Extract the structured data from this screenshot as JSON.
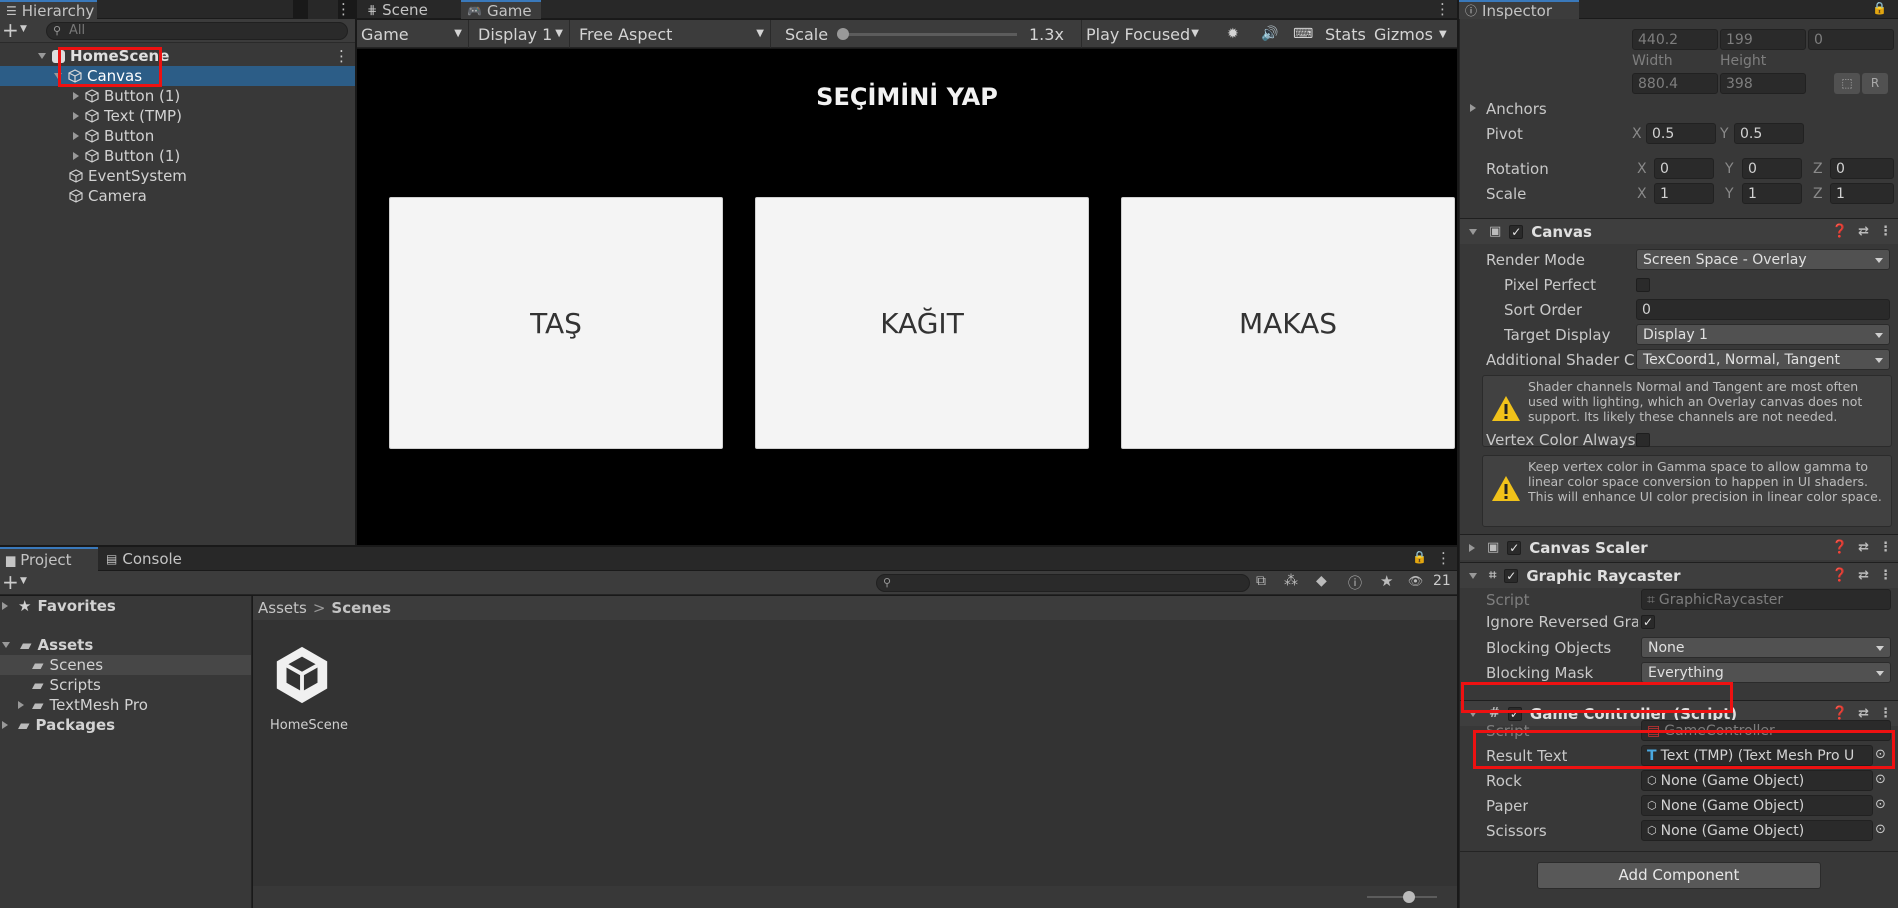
{
  "hierarchy": {
    "tab_label": "Hierarchy",
    "search_placeholder": "All",
    "scene_name": "HomeScene",
    "items": [
      {
        "label": "Canvas"
      },
      {
        "label": "Button (1)"
      },
      {
        "label": "Text (TMP)"
      },
      {
        "label": "Button"
      },
      {
        "label": "Button (1)"
      },
      {
        "label": "EventSystem"
      },
      {
        "label": "Camera"
      }
    ]
  },
  "center_tabs": {
    "scene": "Scene",
    "game": "Game"
  },
  "game_toolbar": {
    "game": "Game",
    "display": "Display 1",
    "aspect": "Free Aspect",
    "scale_label": "Scale",
    "scale_value": "1.3x",
    "play_mode": "Play Focused",
    "stats": "Stats",
    "gizmos": "Gizmos",
    "scale_fraction": 0.0
  },
  "game_view": {
    "title": "SEÇİMİNİ YAP",
    "cards": [
      "TAŞ",
      "KAĞIT",
      "MAKAS"
    ]
  },
  "project": {
    "tabs": {
      "project": "Project",
      "console": "Console"
    },
    "badge": "21",
    "tree": {
      "favorites": "Favorites",
      "assets": "Assets",
      "scenes": "Scenes",
      "scripts": "Scripts",
      "textmesh": "TextMesh Pro",
      "packages": "Packages"
    },
    "breadcrumb": {
      "root": "Assets",
      "sep": ">",
      "current": "Scenes"
    },
    "files": [
      {
        "label": "HomeScene"
      }
    ]
  },
  "inspector": {
    "tab_label": "Inspector",
    "rect": {
      "pos_x": "440.2",
      "pos_y": "199",
      "pos_z": "0",
      "width_label": "Width",
      "height_label": "Height",
      "width": "880.4",
      "height": "398",
      "anchors": "Anchors",
      "pivot": "Pivot",
      "pivot_x": "0.5",
      "pivot_y": "0.5",
      "rotation": "Rotation",
      "scale": "Scale",
      "rot": [
        "0",
        "0",
        "0"
      ],
      "scl": [
        "1",
        "1",
        "1"
      ],
      "x": "X",
      "y": "Y",
      "z": "Z"
    },
    "canvas": {
      "title": "Canvas",
      "render_mode_label": "Render Mode",
      "render_mode": "Screen Space - Overlay",
      "pixel_perfect": "Pixel Perfect",
      "sort_order_label": "Sort Order",
      "sort_order": "0",
      "target_display_label": "Target Display",
      "target_display": "Display 1",
      "shader_label": "Additional Shader Ch",
      "shader_value": "TexCoord1, Normal, Tangent",
      "warning1": "Shader channels Normal and Tangent are most often used with lighting, which an Overlay canvas does not support. Its likely these channels are not needed.",
      "vertex_label": "Vertex Color Always",
      "warning2": "Keep vertex color in Gamma space to allow gamma to linear color space conversion to happen in UI shaders. This will enhance UI color precision in linear color space."
    },
    "canvas_scaler": {
      "title": "Canvas Scaler"
    },
    "raycaster": {
      "title": "Graphic Raycaster",
      "script_label": "Script",
      "script": "GraphicRaycaster",
      "ignore_label": "Ignore Reversed Grap",
      "blocking_objects_label": "Blocking Objects",
      "blocking_objects": "None",
      "blocking_mask_label": "Blocking Mask",
      "blocking_mask": "Everything"
    },
    "game_controller": {
      "title": "Game Controller (Script)",
      "script_label": "Script",
      "script": "GameController",
      "result_label": "Result Text",
      "result_value": "Text (TMP) (Text Mesh Pro U",
      "rock_label": "Rock",
      "rock_value": "None (Game Object)",
      "paper_label": "Paper",
      "paper_value": "None (Game Object)",
      "scissors_label": "Scissors",
      "scissors_value": "None (Game Object)"
    },
    "add_component": "Add Component"
  },
  "colors": {
    "accent": "#3a79bb",
    "selection": "#2c5d87",
    "highlight": "#e11111"
  }
}
